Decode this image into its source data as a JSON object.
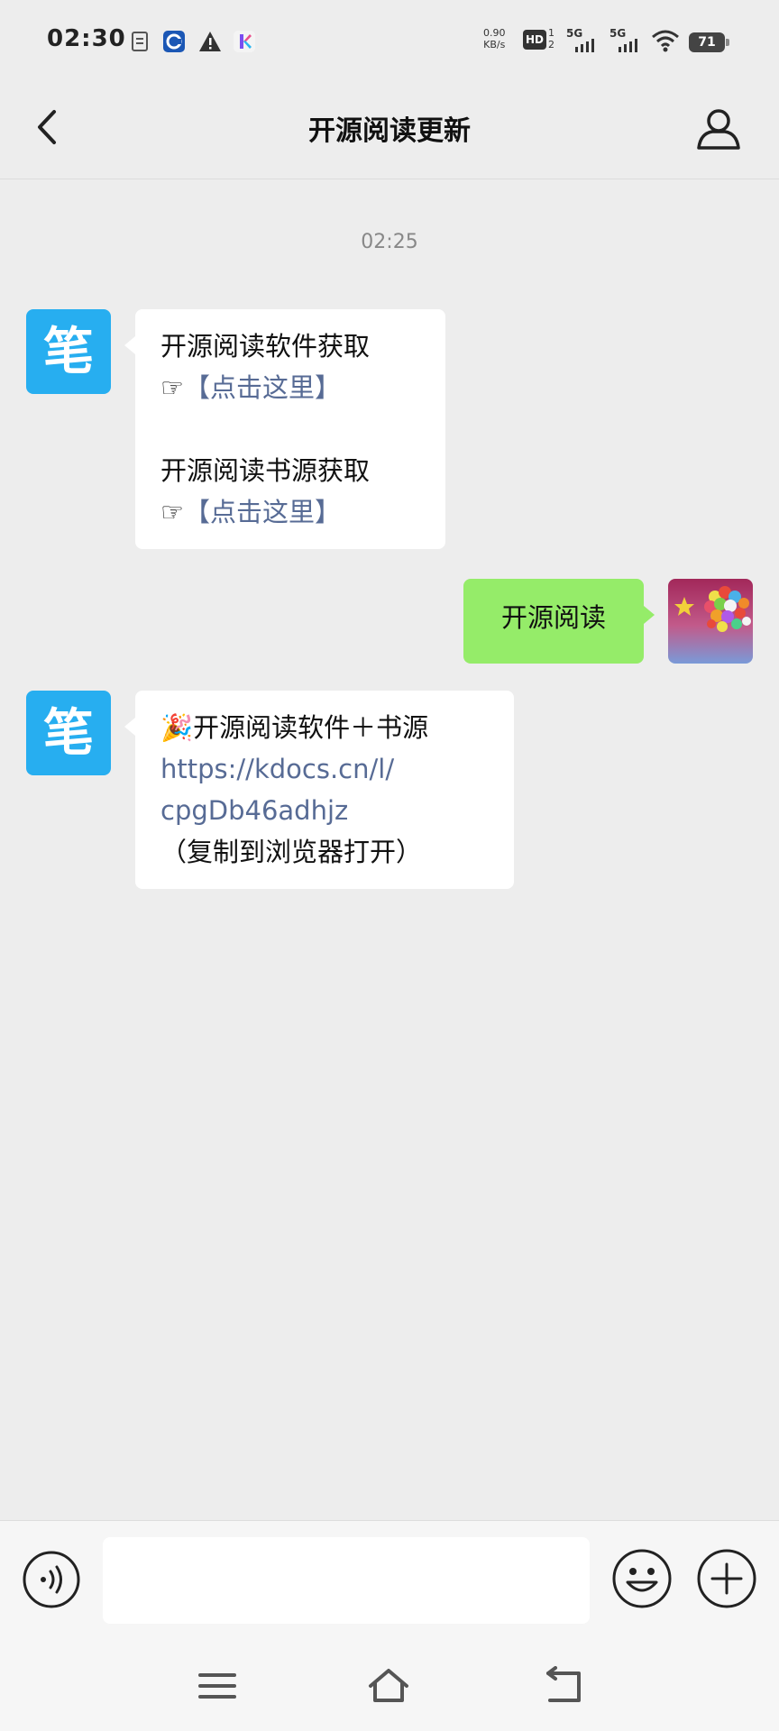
{
  "status_bar": {
    "time": "02:30",
    "speed_value": "0.90",
    "speed_unit": "KB/s",
    "hd_label": "HD",
    "hd_sub": "1\n2",
    "network1": "5G",
    "network2": "5G",
    "battery": "71",
    "icons": [
      "document-icon",
      "app-c-icon",
      "warning-icon",
      "app-k-icon",
      "signal-icon",
      "wifi-icon",
      "battery-icon"
    ]
  },
  "header": {
    "title": "开源阅读更新",
    "back_icon": "chevron-left-icon",
    "profile_icon": "person-icon"
  },
  "chat": {
    "timestamp": "02:25",
    "messages": [
      {
        "sender": "bot",
        "avatar_text": "笔",
        "lines": [
          {
            "text": "开源阅读软件获取"
          },
          {
            "prefix": "☞",
            "link": "【点击这里】"
          },
          {
            "text": ""
          },
          {
            "text": "开源阅读书源获取"
          },
          {
            "prefix": "☞",
            "link": "【点击这里】"
          }
        ]
      },
      {
        "sender": "me",
        "text": "开源阅读"
      },
      {
        "sender": "bot",
        "avatar_text": "笔",
        "lines": [
          {
            "text": "🎉开源阅读软件＋书源"
          },
          {
            "link": "https://kdocs.cn/l/"
          },
          {
            "link": "cpgDb46adhjz"
          },
          {
            "text": "（复制到浏览器打开）"
          }
        ]
      }
    ]
  },
  "input_bar": {
    "placeholder": "",
    "voice_icon": "voice-icon",
    "emoji_icon": "emoji-icon",
    "plus_icon": "plus-icon"
  },
  "nav": [
    "menu-icon",
    "home-icon",
    "back-icon"
  ],
  "colors": {
    "background": "#ededed",
    "my_bubble": "#95ec69",
    "bot_bubble": "#ffffff",
    "link": "#576b95",
    "bot_avatar": "#27aef0"
  }
}
